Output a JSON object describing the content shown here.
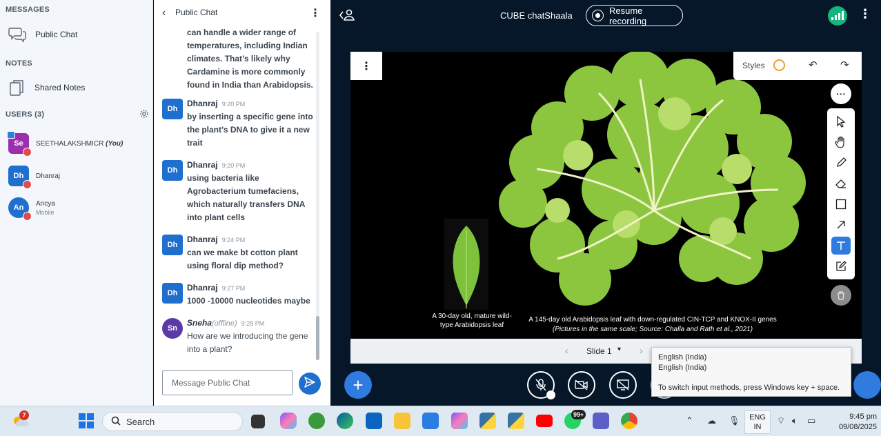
{
  "sidebar": {
    "messages_title": "MESSAGES",
    "public_chat_label": "Public Chat",
    "notes_title": "NOTES",
    "shared_notes_label": "Shared Notes",
    "users_title": "USERS (3)",
    "users": [
      {
        "initials": "Se",
        "name": "SEETHALAKSHMICR",
        "suffix": "(You)",
        "sub": "",
        "color": "#9b2fae"
      },
      {
        "initials": "Dh",
        "name": "Dhanraj",
        "suffix": "",
        "sub": "",
        "color": "#1f6fcf"
      },
      {
        "initials": "An",
        "name": "Ancya",
        "suffix": "",
        "sub": "Mobile",
        "color": "#1f6fcf"
      }
    ]
  },
  "chat": {
    "title": "Public Chat",
    "continued_text": "can handle a wider range of temperatures, including Indian climates. That’s likely why Cardamine is more commonly found in India than Arabidopsis.",
    "messages": [
      {
        "initials": "Dh",
        "author": "Dhanraj",
        "status": "",
        "time": "9:20 PM",
        "text": "by inserting a specific gene into the plant’s DNA to give it a new trait"
      },
      {
        "initials": "Dh",
        "author": "Dhanraj",
        "status": "",
        "time": "9:20 PM",
        "text": "using bacteria like Agrobacterium tumefaciens, which naturally transfers DNA into plant cells"
      },
      {
        "initials": "Dh",
        "author": "Dhanraj",
        "status": "",
        "time": "9:24 PM",
        "text": "can we make bt cotton plant using floral dip method?"
      },
      {
        "initials": "Dh",
        "author": "Dhanraj",
        "status": "",
        "time": "9:27 PM",
        "text": "1000 -10000 nucleotides maybe"
      },
      {
        "initials": "Sn",
        "author": "Sneha",
        "status": "(offline)",
        "time": "9:28 PM",
        "text": "How are we introducing the gene into a plant?"
      }
    ],
    "input_placeholder": "Message Public Chat"
  },
  "main": {
    "meeting_title": "CUBE chatShaala",
    "record_label": "Resume recording",
    "styles_label": "Styles",
    "caption_left": "A 30-day old, mature wild-type Arabidopsis leaf",
    "caption_right_1": "A 145-day old Arabidopsis leaf with down-regulated CIN-TCP and KNOX-II genes",
    "caption_right_2": "(Pictures in the same scale; Source: Challa and Rath et al., 2021)",
    "slide_label": "Slide 1"
  },
  "tooltip": {
    "line1": "English (India)",
    "line2": "English (India)",
    "line3": "To switch input methods, press Windows key + space."
  },
  "taskbar": {
    "search_placeholder": "Search",
    "weather_badge": "7",
    "whatsapp_badge": "99+",
    "lang_line1": "ENG",
    "lang_line2": "IN",
    "time": "9:45 pm",
    "date": "09/08/2025"
  },
  "colors": {
    "accent": "#2f7be0",
    "dark_bg": "#06172a",
    "signal_green": "#16b47d",
    "styles_orange": "#f29a2e"
  }
}
